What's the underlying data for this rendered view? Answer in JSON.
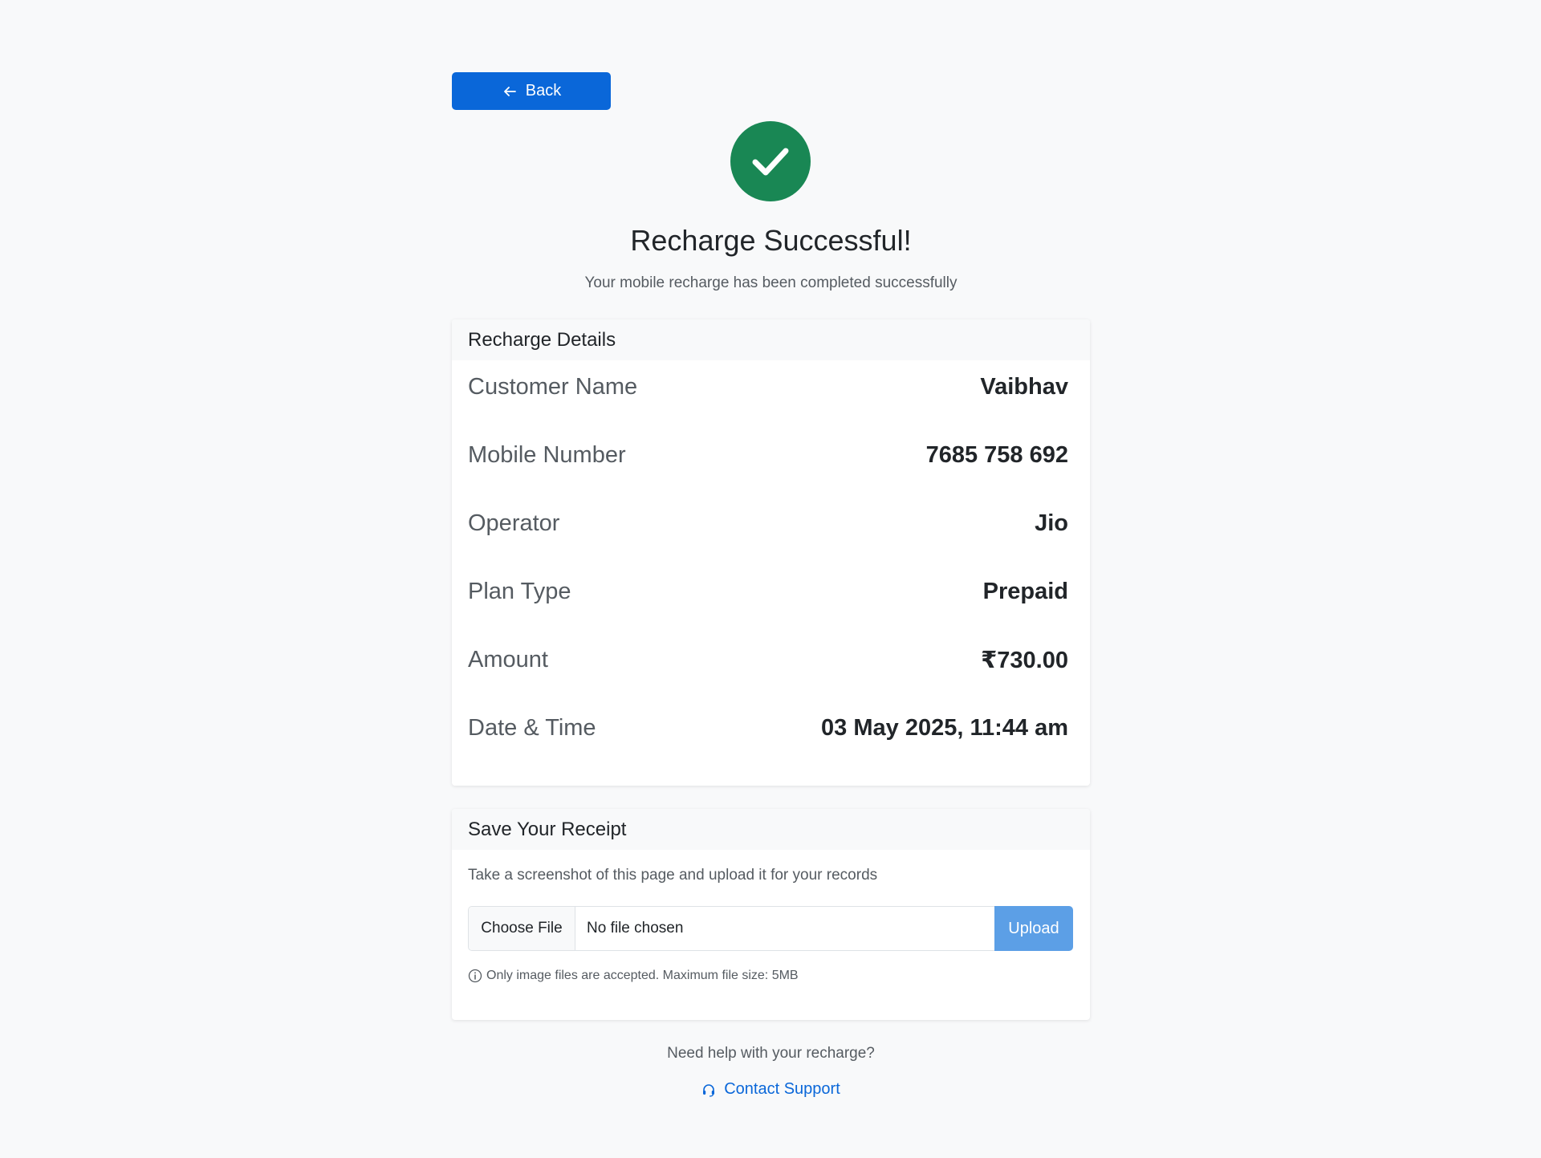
{
  "back": {
    "label": "Back"
  },
  "status": {
    "title": "Recharge Successful!",
    "subtitle": "Your mobile recharge has been completed successfully",
    "color": "#198754"
  },
  "details": {
    "header": "Recharge Details",
    "rows": [
      {
        "label": "Customer Name",
        "value": "Vaibhav"
      },
      {
        "label": "Mobile Number",
        "value": "7685 758 692"
      },
      {
        "label": "Operator",
        "value": "Jio"
      },
      {
        "label": "Plan Type",
        "value": "Prepaid"
      },
      {
        "label": "Amount",
        "value": "₹730.00"
      },
      {
        "label": "Date & Time",
        "value": "03 May 2025, 11:44 am"
      }
    ]
  },
  "receipt": {
    "header": "Save Your Receipt",
    "instruction": "Take a screenshot of this page and upload it for your records",
    "choose_label": "Choose File",
    "file_status": "No file chosen",
    "upload_label": "Upload",
    "hint": "Only image files are accepted. Maximum file size: 5MB"
  },
  "help": {
    "question": "Need help with your recharge?",
    "link_label": "Contact Support"
  },
  "colors": {
    "primary": "#0a67d9",
    "success": "#198754",
    "upload_disabled": "#5c9fe6"
  }
}
